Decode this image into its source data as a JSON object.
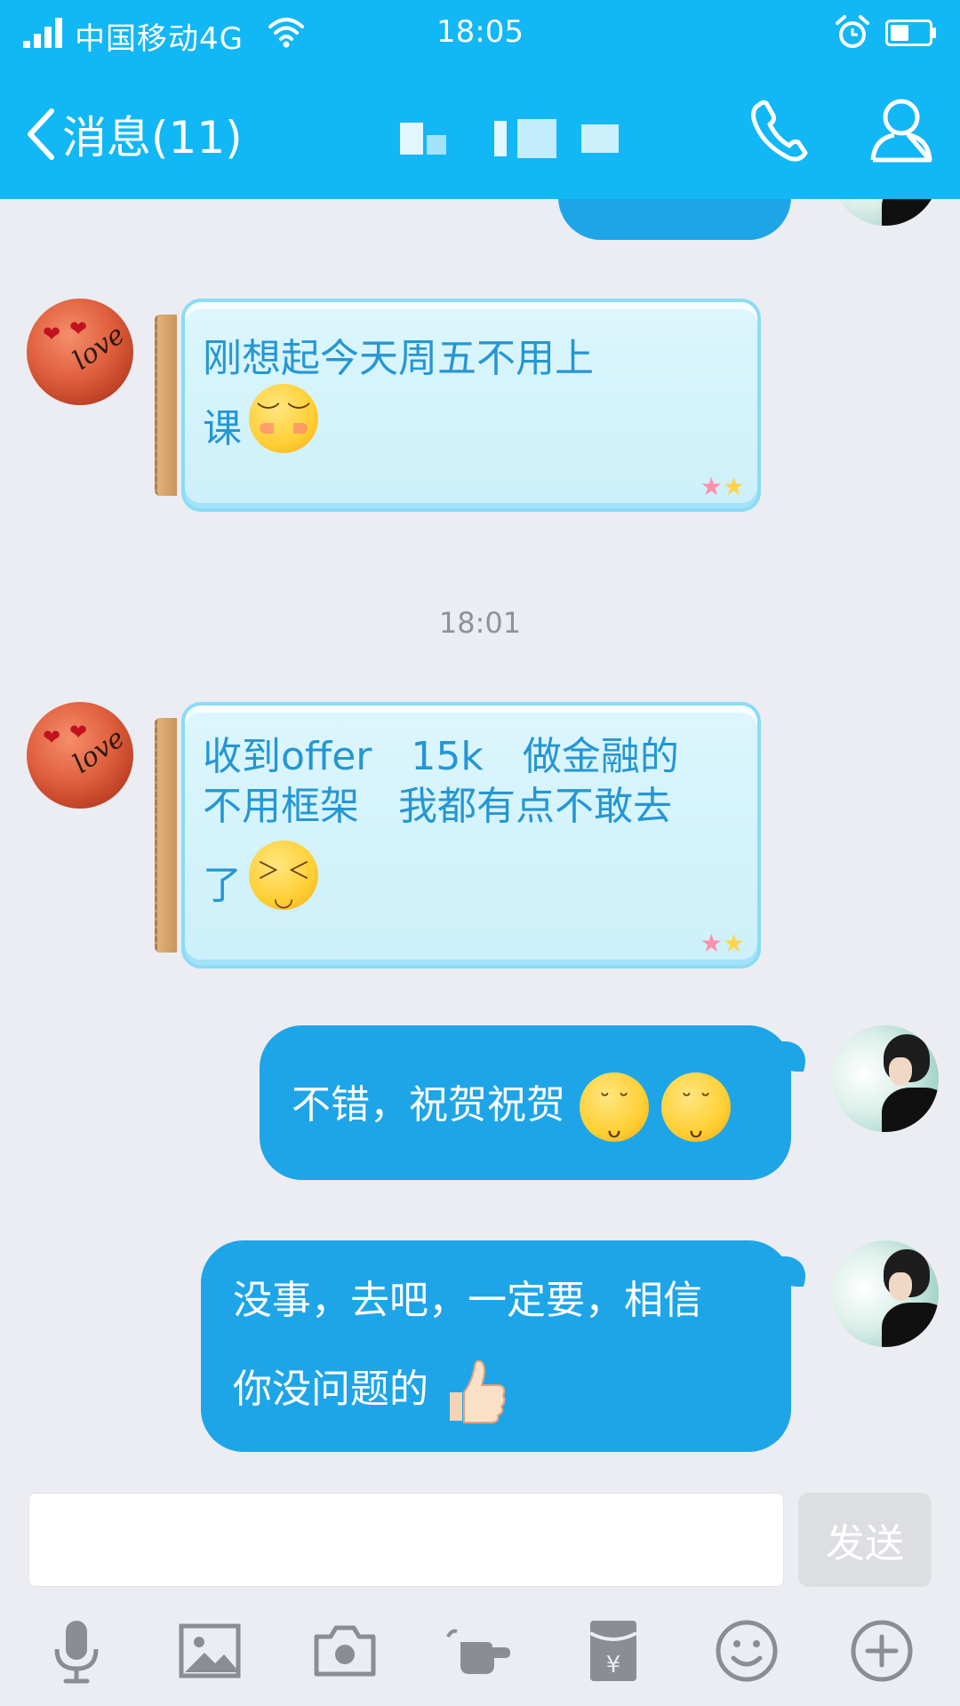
{
  "status": {
    "carrier": "中国移动4G",
    "time": "18:05"
  },
  "nav": {
    "back_label": "消息(11)"
  },
  "messages": [
    {
      "from": "contact",
      "text": "刚想起今天周五不用上课",
      "emoji": "bashful-smile"
    },
    {
      "timestamp": "18:01"
    },
    {
      "from": "contact",
      "text": "收到offer　15k　做金融的不用框架　我都有点不敢去了",
      "emoji": "tears-of-joy"
    },
    {
      "from": "me",
      "text": "不错，祝贺祝贺",
      "emoji": [
        "pray-emoji",
        "pray-emoji"
      ]
    },
    {
      "from": "me",
      "text": "没事，去吧，一定要，相信你没问题的",
      "emoji": "thumbs-up"
    }
  ],
  "msg1": {
    "line1": "刚想起今天周五不用上",
    "line2": "课"
  },
  "time_divider": "18:01",
  "msg2": {
    "line1": "收到offer　15k　做金融的",
    "line2": "不用框架　我都有点不敢去",
    "line3": "了"
  },
  "msg3": {
    "text": "不错，祝贺祝贺"
  },
  "msg4": {
    "line1": "没事，去吧，一定要，相信",
    "line2": "你没问题的"
  },
  "input": {
    "value": "",
    "send_label": "发送"
  },
  "toolbar": [
    "microphone-icon",
    "image-icon",
    "camera-icon",
    "poke-icon",
    "red-packet-icon",
    "emoji-icon",
    "plus-icon"
  ],
  "colors": {
    "topbar": "#12b7f5",
    "sent_bubble": "#1ea5e8",
    "received_text": "#2596d4",
    "background": "#ebedf2"
  }
}
